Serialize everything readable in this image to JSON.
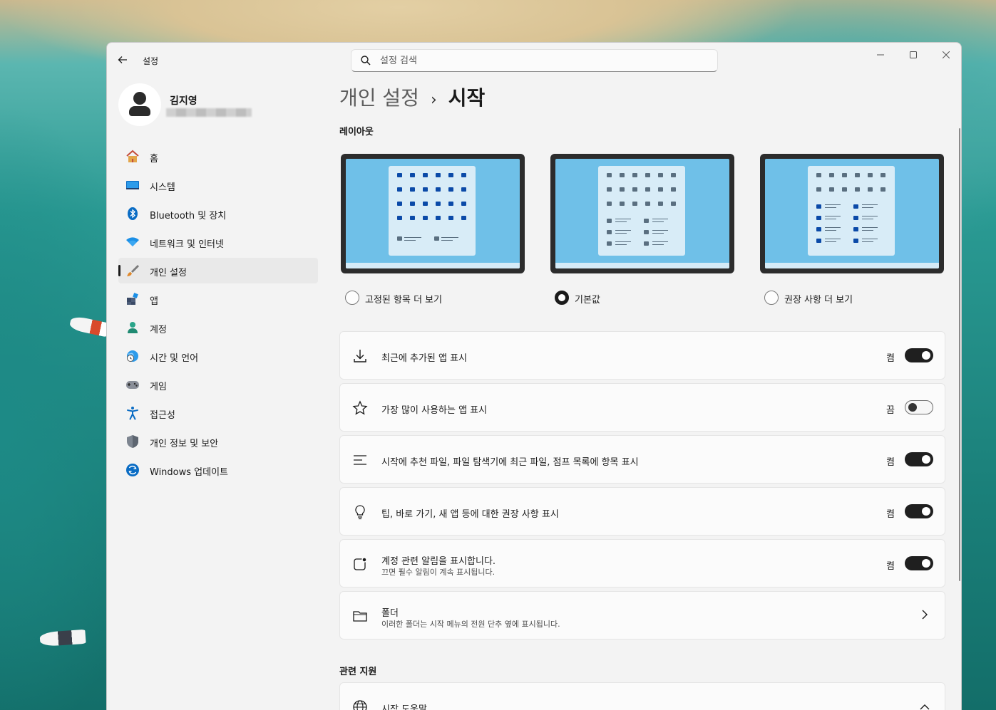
{
  "app": {
    "title": "설정"
  },
  "search": {
    "placeholder": "설정 검색"
  },
  "profile": {
    "name": "김지영"
  },
  "nav": {
    "items": [
      {
        "label": "홈",
        "icon": "home-icon"
      },
      {
        "label": "시스템",
        "icon": "system-icon"
      },
      {
        "label": "Bluetooth 및 장치",
        "icon": "bluetooth-icon"
      },
      {
        "label": "네트워크 및 인터넷",
        "icon": "wifi-icon"
      },
      {
        "label": "개인 설정",
        "icon": "brush-icon",
        "active": true
      },
      {
        "label": "앱",
        "icon": "apps-icon"
      },
      {
        "label": "계정",
        "icon": "account-icon"
      },
      {
        "label": "시간 및 언어",
        "icon": "globe-clock-icon"
      },
      {
        "label": "게임",
        "icon": "gamepad-icon"
      },
      {
        "label": "접근성",
        "icon": "accessibility-icon"
      },
      {
        "label": "개인 정보 및 보안",
        "icon": "shield-icon"
      },
      {
        "label": "Windows 업데이트",
        "icon": "update-icon"
      }
    ]
  },
  "breadcrumb": {
    "parent": "개인 설정",
    "separator": "›",
    "current": "시작"
  },
  "layout_section": {
    "title": "레이아웃",
    "options": [
      {
        "label": "고정된 항목 더 보기",
        "selected": false
      },
      {
        "label": "기본값",
        "selected": true
      },
      {
        "label": "권장 사항 더 보기",
        "selected": false
      }
    ]
  },
  "settings": [
    {
      "title": "최근에 추가된 앱 표시",
      "subtitle": "",
      "state": "켬",
      "on": true,
      "icon": "download-icon"
    },
    {
      "title": "가장 많이 사용하는 앱 표시",
      "subtitle": "",
      "state": "끔",
      "on": false,
      "icon": "star-icon"
    },
    {
      "title": "시작에 추천 파일, 파일 탐색기에 최근 파일, 점프 목록에 항목 표시",
      "subtitle": "",
      "state": "켬",
      "on": true,
      "icon": "list-icon"
    },
    {
      "title": "팁, 바로 가기, 새 앱 등에 대한 권장 사항 표시",
      "subtitle": "",
      "state": "켬",
      "on": true,
      "icon": "lightbulb-icon"
    },
    {
      "title": "계정 관련 알림을 표시합니다.",
      "subtitle": "끄면 필수 알림이 계속 표시됩니다.",
      "state": "켬",
      "on": true,
      "icon": "notification-icon"
    },
    {
      "title": "폴더",
      "subtitle": "이러한 폴더는 시작 메뉴의 전원 단추 옆에 표시됩니다.",
      "icon": "folder-icon"
    }
  ],
  "related": {
    "title": "관련 지원",
    "items": [
      {
        "title": "시작 도움말",
        "icon": "globe-icon"
      }
    ]
  },
  "colors": {
    "accent": "#0067c0",
    "toggle_on": "#1f1f1f",
    "window_bg": "#f3f3f3"
  }
}
